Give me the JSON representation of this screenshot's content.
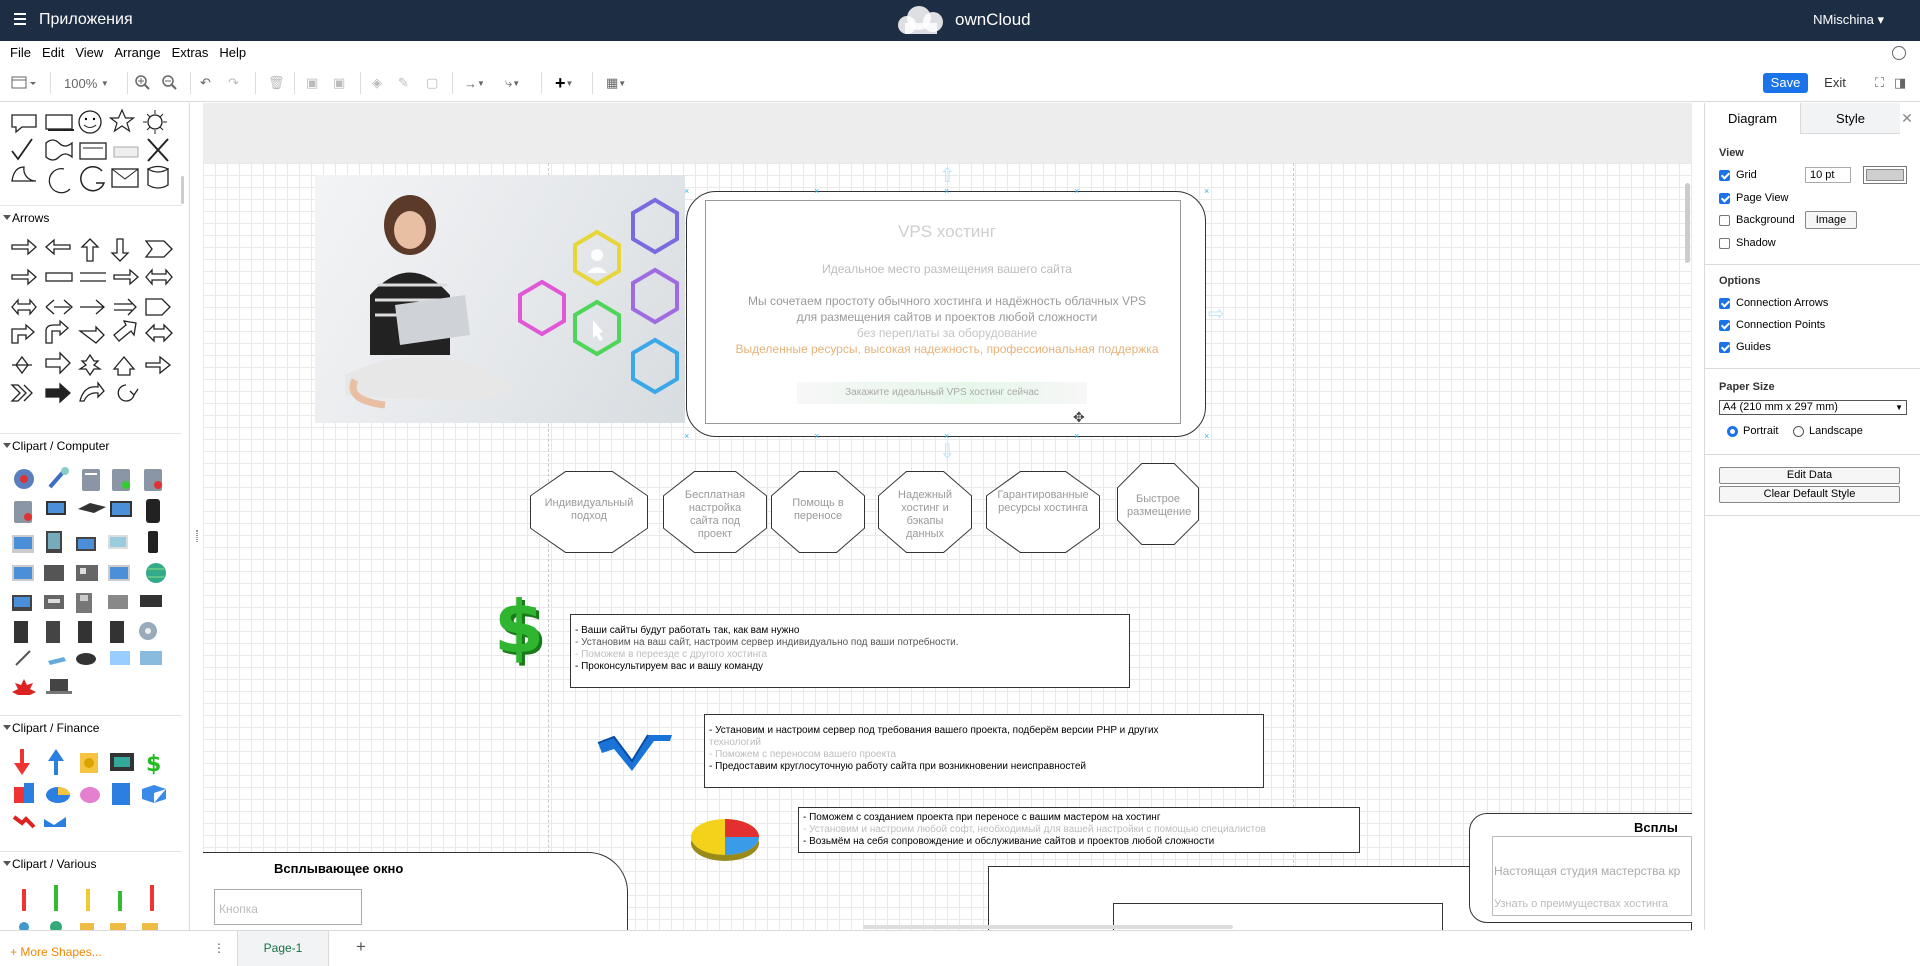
{
  "topbar": {
    "apps_label": "Приложения",
    "brand": "ownCloud",
    "user": "NMischina ▾"
  },
  "menu": [
    "File",
    "Edit",
    "View",
    "Arrange",
    "Extras",
    "Help"
  ],
  "toolbar": {
    "zoom": "100%",
    "save": "Save",
    "exit": "Exit"
  },
  "sidebar": {
    "sections": [
      "Arrows",
      "Clipart / Computer",
      "Clipart / Finance",
      "Clipart / Various"
    ],
    "more_shapes": "+ More Shapes..."
  },
  "right_panel": {
    "tabs": [
      "Diagram",
      "Style"
    ],
    "view_title": "View",
    "grid_label": "Grid",
    "grid_size": "10 pt",
    "page_view": "Page View",
    "background": "Background",
    "image_button": "Image",
    "shadow": "Shadow",
    "options_title": "Options",
    "connection_arrows": "Connection Arrows",
    "connection_points": "Connection Points",
    "guides": "Guides",
    "paper_title": "Paper Size",
    "paper_value": "A4 (210 mm x 297 mm)",
    "portrait": "Portrait",
    "landscape": "Landscape",
    "edit_data": "Edit Data",
    "clear_style": "Clear Default Style",
    "grid_color": "#cfcfcf"
  },
  "bottom": {
    "page_tab": "Page-1"
  },
  "diagram": {
    "vps_title": "VPS хостинг",
    "vps_sub": "Идеальное место размещения вашего сайта",
    "vps_lines": [
      "Мы сочетаем простоту обычного хостинга и надёжность облачных VPS",
      "для размещения сайтов и проектов любой сложности",
      "без переплаты за оборудование",
      "Выделенные ресурсы, высокая надежность, профессиональная поддержка"
    ],
    "vps_button": "Закажите идеальный VPS хостинг сейчас",
    "octagons": [
      "Индивидуальный подход",
      "Бесплатная настройка сайта под проект",
      "Помощь в переносе",
      "Надежный хостинг и бэкапы данных",
      "Гарантированные ресурсы хостинга",
      "Быстрое размещение"
    ],
    "list1": [
      "- Ваши сайты будут работать так, как вам нужно",
      "- Установим на ваш сайт, настроим сервер индивидуально под ваши потребности.",
      "- Поможем в переезде с другого хостинга",
      "- Проконсультируем вас и вашу команду"
    ],
    "list2": [
      "- Установим и настроим сервер под требования вашего проекта, подберём версии PHP и других",
      "   технологий",
      "- Поможем с переносом вашего проекта",
      "- Предоставим круглосуточную работу сайта при возникновении неисправностей"
    ],
    "list3": [
      "- Поможем с созданием проекта при переносе с вашим мастером на хостинг",
      "- Установим и настроим любой софт, необходимый для вашей настройки с помощью специалистов",
      "- Возьмём на себя сопровождение и обслуживание сайтов и проектов любой сложности"
    ],
    "popup_title": "Всплывающее окно",
    "popup_button": "Кнопка",
    "popup_right_title": "Всплы",
    "popup_right_line1": "Настоящая студия мастерства кр",
    "popup_right_line2": "Узнать о преимуществах хостинга"
  }
}
